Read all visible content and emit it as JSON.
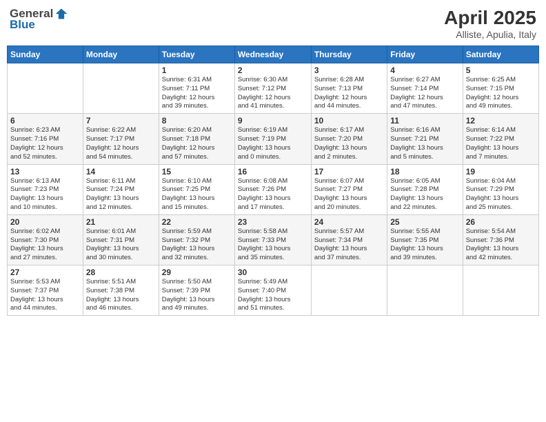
{
  "logo": {
    "general": "General",
    "blue": "Blue"
  },
  "header": {
    "title": "April 2025",
    "subtitle": "Alliste, Apulia, Italy"
  },
  "weekdays": [
    "Sunday",
    "Monday",
    "Tuesday",
    "Wednesday",
    "Thursday",
    "Friday",
    "Saturday"
  ],
  "weeks": [
    [
      {
        "day": "",
        "info": ""
      },
      {
        "day": "",
        "info": ""
      },
      {
        "day": "1",
        "info": "Sunrise: 6:31 AM\nSunset: 7:11 PM\nDaylight: 12 hours\nand 39 minutes."
      },
      {
        "day": "2",
        "info": "Sunrise: 6:30 AM\nSunset: 7:12 PM\nDaylight: 12 hours\nand 41 minutes."
      },
      {
        "day": "3",
        "info": "Sunrise: 6:28 AM\nSunset: 7:13 PM\nDaylight: 12 hours\nand 44 minutes."
      },
      {
        "day": "4",
        "info": "Sunrise: 6:27 AM\nSunset: 7:14 PM\nDaylight: 12 hours\nand 47 minutes."
      },
      {
        "day": "5",
        "info": "Sunrise: 6:25 AM\nSunset: 7:15 PM\nDaylight: 12 hours\nand 49 minutes."
      }
    ],
    [
      {
        "day": "6",
        "info": "Sunrise: 6:23 AM\nSunset: 7:16 PM\nDaylight: 12 hours\nand 52 minutes."
      },
      {
        "day": "7",
        "info": "Sunrise: 6:22 AM\nSunset: 7:17 PM\nDaylight: 12 hours\nand 54 minutes."
      },
      {
        "day": "8",
        "info": "Sunrise: 6:20 AM\nSunset: 7:18 PM\nDaylight: 12 hours\nand 57 minutes."
      },
      {
        "day": "9",
        "info": "Sunrise: 6:19 AM\nSunset: 7:19 PM\nDaylight: 13 hours\nand 0 minutes."
      },
      {
        "day": "10",
        "info": "Sunrise: 6:17 AM\nSunset: 7:20 PM\nDaylight: 13 hours\nand 2 minutes."
      },
      {
        "day": "11",
        "info": "Sunrise: 6:16 AM\nSunset: 7:21 PM\nDaylight: 13 hours\nand 5 minutes."
      },
      {
        "day": "12",
        "info": "Sunrise: 6:14 AM\nSunset: 7:22 PM\nDaylight: 13 hours\nand 7 minutes."
      }
    ],
    [
      {
        "day": "13",
        "info": "Sunrise: 6:13 AM\nSunset: 7:23 PM\nDaylight: 13 hours\nand 10 minutes."
      },
      {
        "day": "14",
        "info": "Sunrise: 6:11 AM\nSunset: 7:24 PM\nDaylight: 13 hours\nand 12 minutes."
      },
      {
        "day": "15",
        "info": "Sunrise: 6:10 AM\nSunset: 7:25 PM\nDaylight: 13 hours\nand 15 minutes."
      },
      {
        "day": "16",
        "info": "Sunrise: 6:08 AM\nSunset: 7:26 PM\nDaylight: 13 hours\nand 17 minutes."
      },
      {
        "day": "17",
        "info": "Sunrise: 6:07 AM\nSunset: 7:27 PM\nDaylight: 13 hours\nand 20 minutes."
      },
      {
        "day": "18",
        "info": "Sunrise: 6:05 AM\nSunset: 7:28 PM\nDaylight: 13 hours\nand 22 minutes."
      },
      {
        "day": "19",
        "info": "Sunrise: 6:04 AM\nSunset: 7:29 PM\nDaylight: 13 hours\nand 25 minutes."
      }
    ],
    [
      {
        "day": "20",
        "info": "Sunrise: 6:02 AM\nSunset: 7:30 PM\nDaylight: 13 hours\nand 27 minutes."
      },
      {
        "day": "21",
        "info": "Sunrise: 6:01 AM\nSunset: 7:31 PM\nDaylight: 13 hours\nand 30 minutes."
      },
      {
        "day": "22",
        "info": "Sunrise: 5:59 AM\nSunset: 7:32 PM\nDaylight: 13 hours\nand 32 minutes."
      },
      {
        "day": "23",
        "info": "Sunrise: 5:58 AM\nSunset: 7:33 PM\nDaylight: 13 hours\nand 35 minutes."
      },
      {
        "day": "24",
        "info": "Sunrise: 5:57 AM\nSunset: 7:34 PM\nDaylight: 13 hours\nand 37 minutes."
      },
      {
        "day": "25",
        "info": "Sunrise: 5:55 AM\nSunset: 7:35 PM\nDaylight: 13 hours\nand 39 minutes."
      },
      {
        "day": "26",
        "info": "Sunrise: 5:54 AM\nSunset: 7:36 PM\nDaylight: 13 hours\nand 42 minutes."
      }
    ],
    [
      {
        "day": "27",
        "info": "Sunrise: 5:53 AM\nSunset: 7:37 PM\nDaylight: 13 hours\nand 44 minutes."
      },
      {
        "day": "28",
        "info": "Sunrise: 5:51 AM\nSunset: 7:38 PM\nDaylight: 13 hours\nand 46 minutes."
      },
      {
        "day": "29",
        "info": "Sunrise: 5:50 AM\nSunset: 7:39 PM\nDaylight: 13 hours\nand 49 minutes."
      },
      {
        "day": "30",
        "info": "Sunrise: 5:49 AM\nSunset: 7:40 PM\nDaylight: 13 hours\nand 51 minutes."
      },
      {
        "day": "",
        "info": ""
      },
      {
        "day": "",
        "info": ""
      },
      {
        "day": "",
        "info": ""
      }
    ]
  ]
}
